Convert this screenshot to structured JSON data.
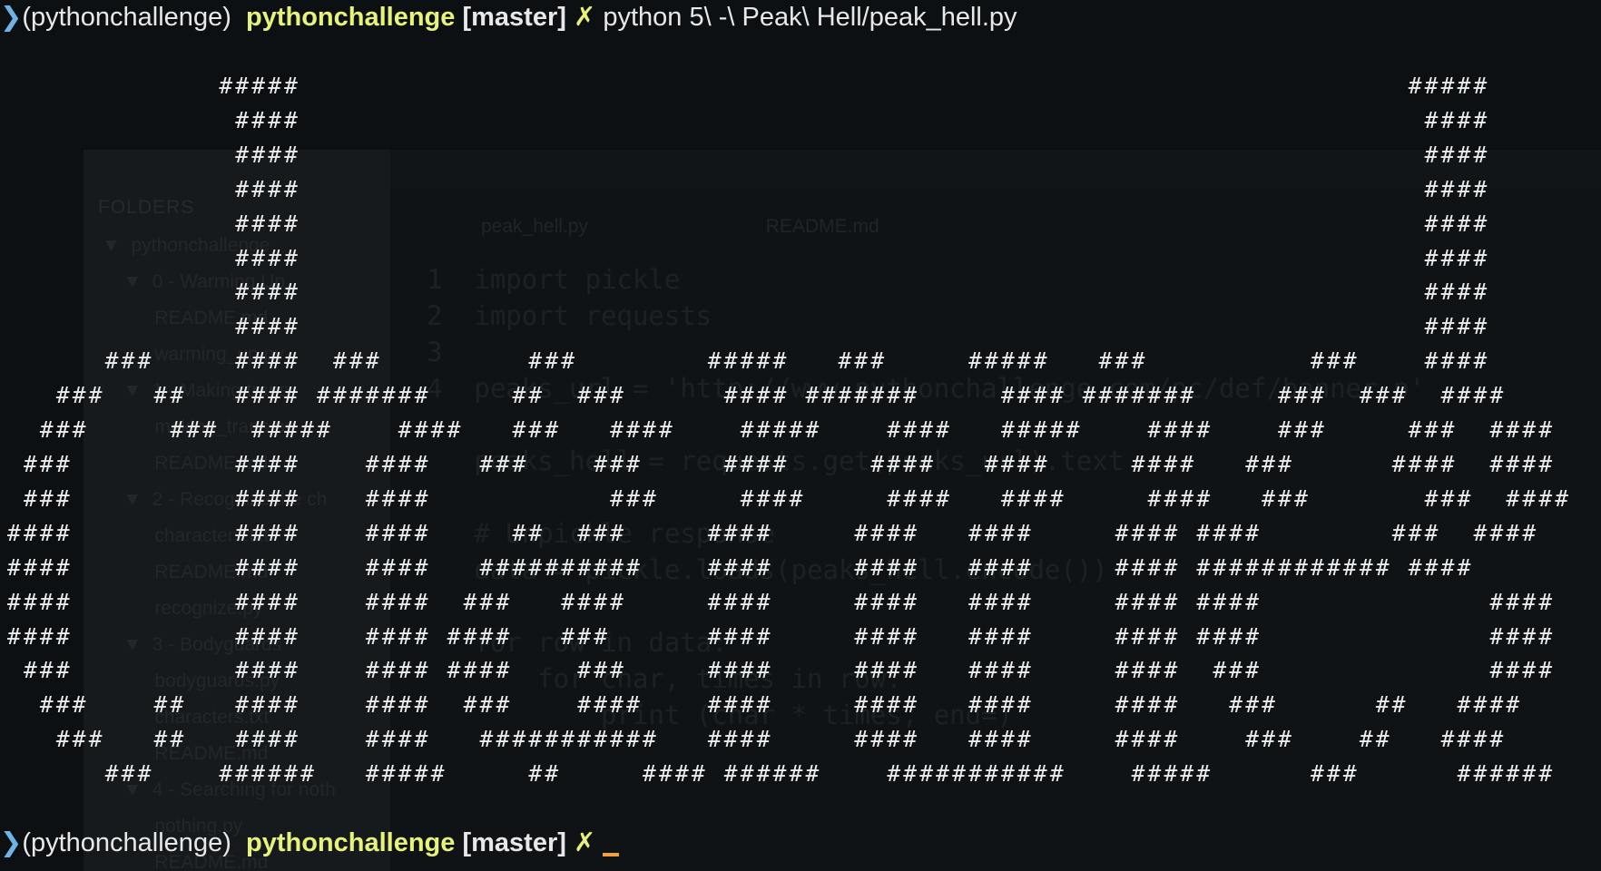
{
  "terminal": {
    "marker": "❯",
    "venv": "(pythonchallenge)",
    "repo": "pythonchallenge",
    "branch": "[master]",
    "dirty": "✗",
    "command": "python 5\\ -\\ Peak\\ Hell/peak_hell.py",
    "output_lines": [
      "             #####                                                                    #####",
      "              ####                                                                     ####",
      "              ####                                                                     ####",
      "              ####                                                                     ####",
      "              ####                                                                     ####",
      "              ####                                                                     ####",
      "              ####                                                                     ####",
      "              ####                                                                     ####",
      "      ###     ####  ###         ###        #####   ###     #####   ###          ###    ####",
      "   ###   ##   #### #######     ##  ###      #### #######     #### #######     ###  ###  ####",
      "  ###     ###  #####    ####   ###   ####    #####    ####   #####    ####    ###     ###  ####",
      " ###          ####    ####   ###    ###     ####     ####   ####     ####   ###      ####  ####",
      " ###          ####    ####           ###     ####     ####   ####     ####   ###       ###  ####",
      "####          ####    ####     ##  ###     ####     ####   ####     #### ####        ###  ####",
      "####          ####    ####   ##########    ####     ####   ####     #### ############ ####",
      "####          ####    ####  ###   ####     ####     ####   ####     #### ####              ####",
      "####          ####    #### ####   ###      ####     ####   ####     #### ####              ####",
      " ###          ####    #### ####    ###     ####     ####   ####     ####  ###              ####",
      "  ###    ##   ####    ####  ###    ####    ####     ####   ####     ####   ###      ##   ####",
      "   ###   ##   ####    ####   ###########   ####     ####   ####     ####    ###    ##   ####",
      "      ###    ######   #####     ##     #### ######    ###########    #####      ###      ######"
    ]
  },
  "background_editor": {
    "sidebar_title": "FOLDERS",
    "tree": [
      "▼  pythonchallenge",
      "    ▼  0 - Warming Up",
      "          README.md",
      "          warming_up.py",
      "    ▼  1 - Making trans",
      "          making_trans.py",
      "          README.md",
      "    ▼  2 - Recognize the ch",
      "          characters.txt",
      "          README.md",
      "          recognize.py",
      "    ▼  3 - Bodyguards",
      "          bodyguards.py",
      "          characters.txt",
      "          README.md",
      "    ▼  4 - Searching for noth",
      "          nothing.py",
      "          README.md"
    ],
    "tabs": [
      "peak_hell.py",
      "README.md"
    ],
    "code_lines": [
      "1  import pickle",
      "2  import requests",
      "3",
      "4  peaks_url = 'http://www.pythonchallenge.com/pc/def/banner.p'",
      "",
      "   peaks_hell = requests.get(peaks_url).text",
      "",
      "   # Unpickle response",
      "   data = pickle.loads(peaks_hell.encode())",
      "",
      "   for row in data:",
      "       for char, times in row:",
      "           print (char * times, end=)"
    ]
  }
}
